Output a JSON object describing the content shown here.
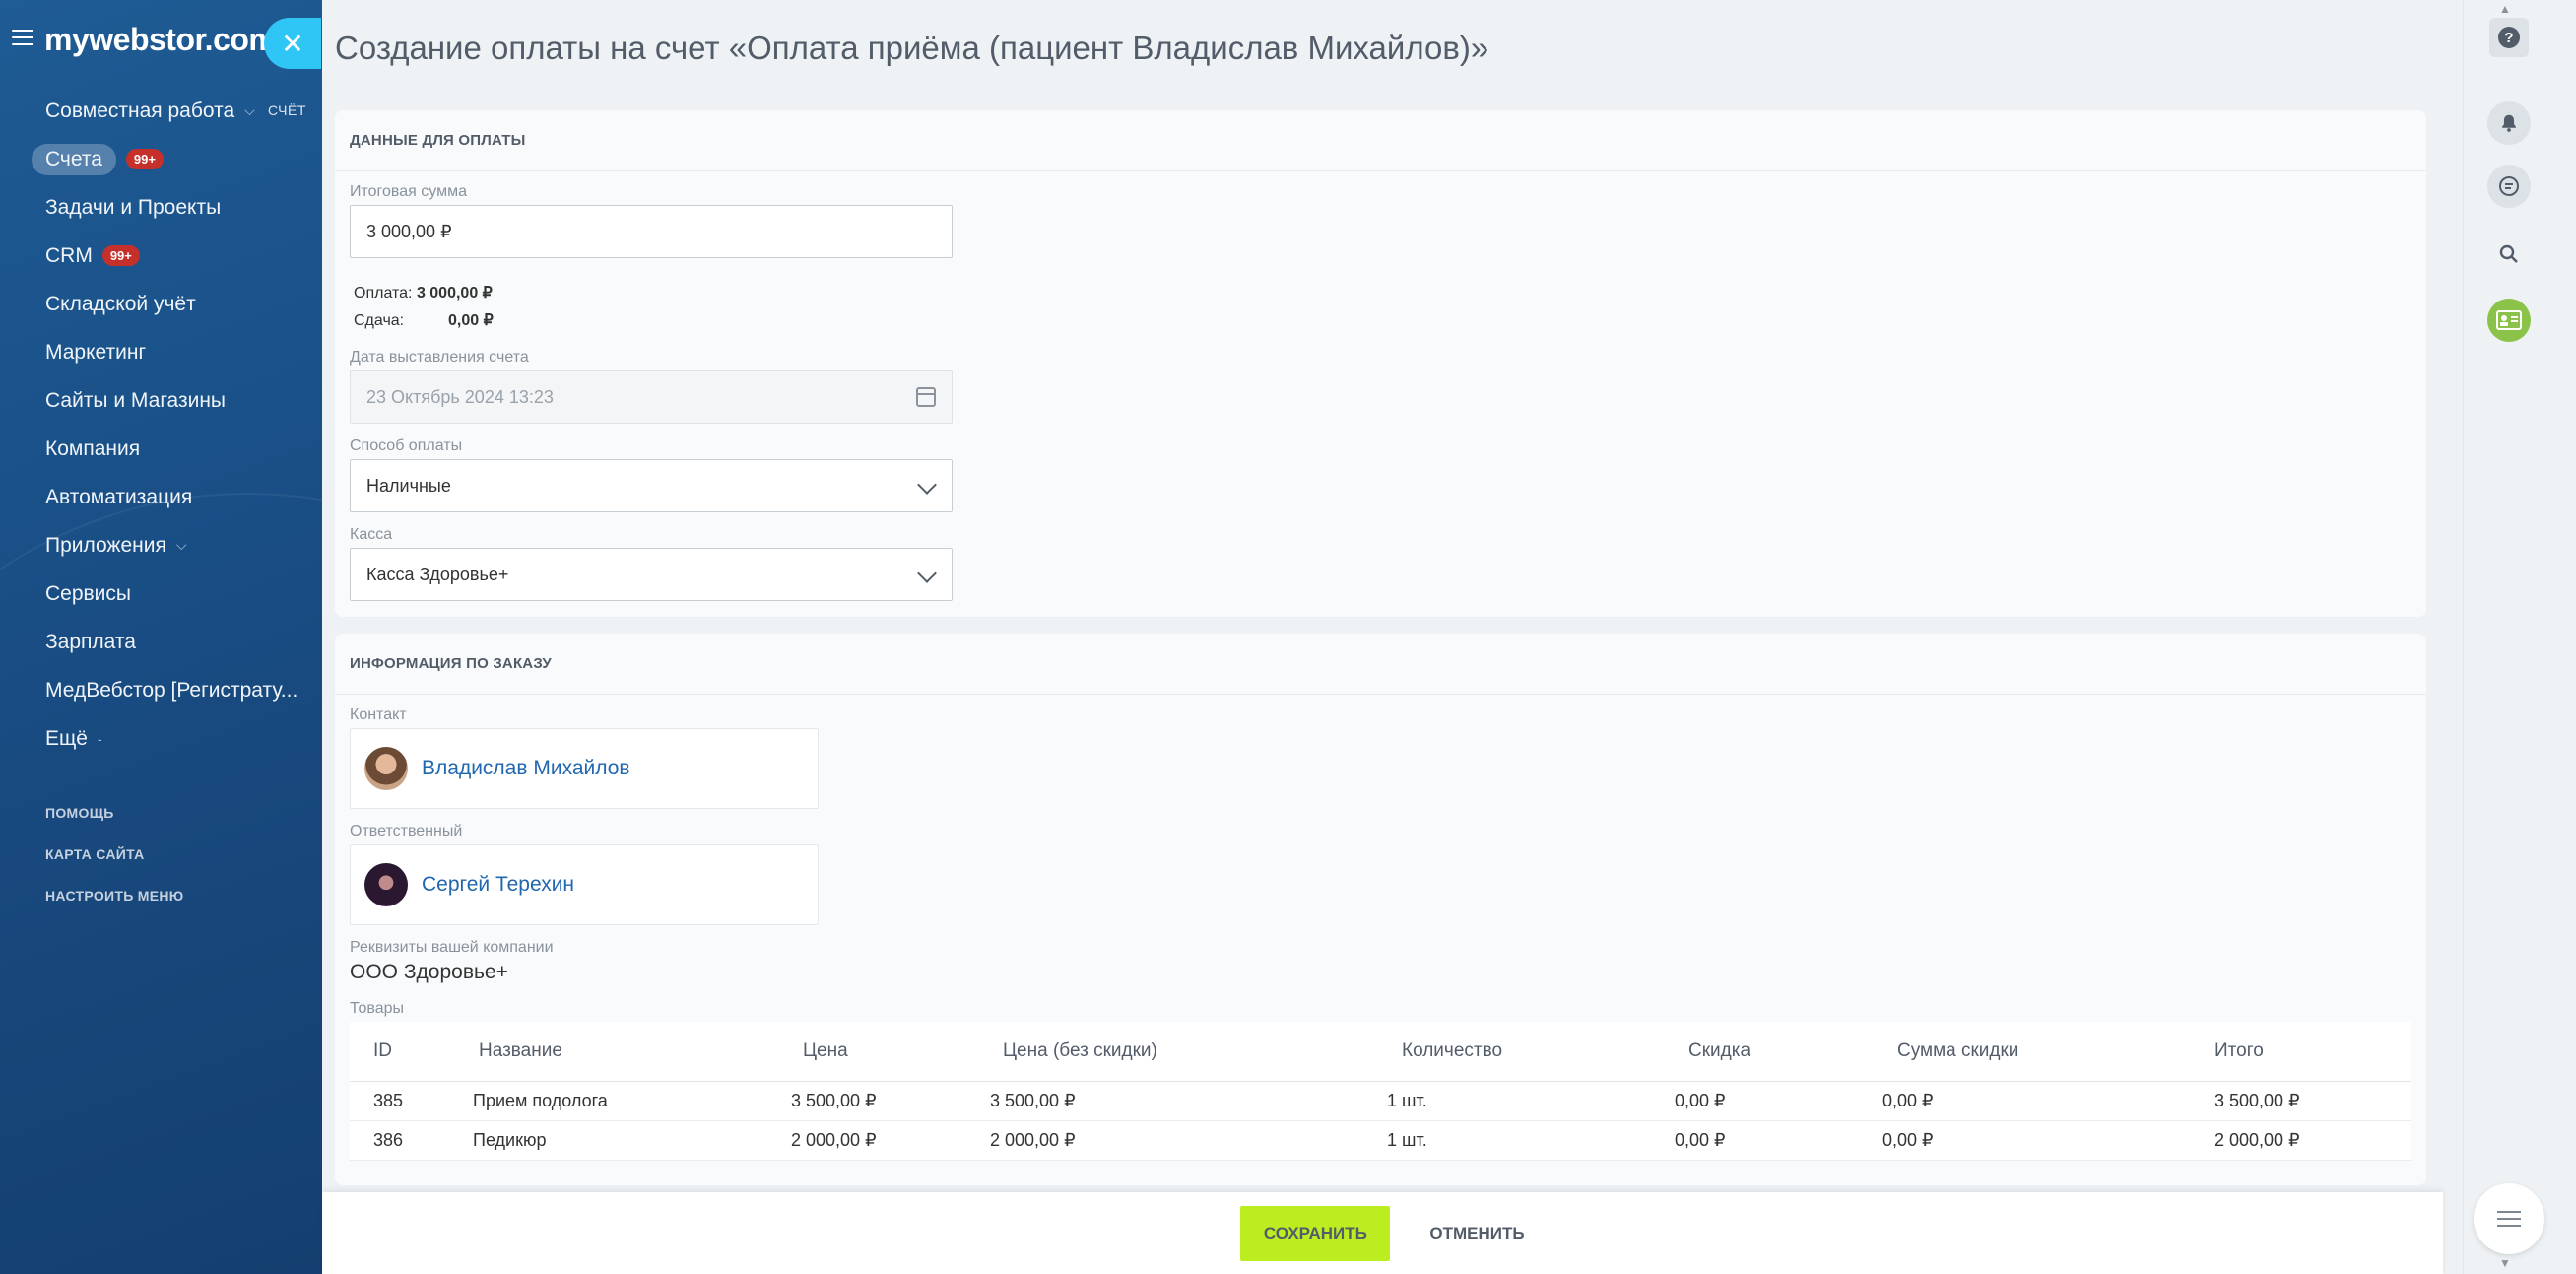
{
  "sidebar": {
    "logo": "mywebstor.com",
    "items": [
      {
        "label": "Совместная работа",
        "badge": "",
        "chevron": true
      },
      {
        "label": "Счета",
        "badge": "99+",
        "chevron": false,
        "active": true
      },
      {
        "label": "Задачи и Проекты",
        "badge": "",
        "chevron": false
      },
      {
        "label": "CRM",
        "badge": "99+",
        "chevron": false
      },
      {
        "label": "Складской учёт",
        "badge": "",
        "chevron": false
      },
      {
        "label": "Маркетинг",
        "badge": "",
        "chevron": false
      },
      {
        "label": "Сайты и Магазины",
        "badge": "",
        "chevron": false
      },
      {
        "label": "Компания",
        "badge": "",
        "chevron": false
      },
      {
        "label": "Автоматизация",
        "badge": "",
        "chevron": false
      },
      {
        "label": "Приложения",
        "badge": "",
        "chevron": true
      },
      {
        "label": "Сервисы",
        "badge": "",
        "chevron": false
      },
      {
        "label": "Зарплата",
        "badge": "",
        "chevron": false
      },
      {
        "label": "МедВебстор [Регистрату...",
        "badge": "",
        "chevron": false
      },
      {
        "label": "Ещё",
        "badge": "",
        "chevron": true
      }
    ],
    "submenu": [
      "ПОМОЩЬ",
      "КАРТА САЙТА",
      "НАСТРОИТЬ МЕНЮ"
    ]
  },
  "slider": {
    "close_icon": "close-icon",
    "label": "СЧЁТ"
  },
  "page": {
    "title": "Создание оплаты на счет «Оплата приёма (пациент Владислав Михайлов)»"
  },
  "payment": {
    "section_title": "ДАННЫЕ ДЛЯ ОПЛАТЫ",
    "total_label": "Итоговая сумма",
    "total_value": "3 000,00 ₽",
    "paid_label": "Оплата:",
    "paid_value": "3 000,00 ₽",
    "change_label": "Сдача:",
    "change_value": "0,00 ₽",
    "date_label": "Дата выставления счета",
    "date_value": "23 Октябрь 2024 13:23",
    "method_label": "Способ оплаты",
    "method_value": "Наличные",
    "cashbox_label": "Касса",
    "cashbox_value": "Касса Здоровье+"
  },
  "order": {
    "section_title": "ИНФОРМАЦИЯ ПО ЗАКАЗУ",
    "contact_label": "Контакт",
    "contact_name": "Владислав Михайлов",
    "responsible_label": "Ответственный",
    "responsible_name": "Сергей Терехин",
    "company_label": "Реквизиты вашей компании",
    "company_value": "ООО Здоровье+",
    "goods_label": "Товары",
    "columns": [
      "ID",
      "Название",
      "Цена",
      "Цена (без скидки)",
      "Количество",
      "Скидка",
      "Сумма скидки",
      "Итого"
    ],
    "rows": [
      [
        "385",
        "Прием подолога",
        "3 500,00 ₽",
        "3 500,00 ₽",
        "1 шт.",
        "0,00 ₽",
        "0,00 ₽",
        "3 500,00 ₽"
      ],
      [
        "386",
        "Педикюр",
        "2 000,00 ₽",
        "2 000,00 ₽",
        "1 шт.",
        "0,00 ₽",
        "0,00 ₽",
        "2 000,00 ₽"
      ]
    ]
  },
  "actions": {
    "save": "СОХРАНИТЬ",
    "cancel": "ОТМЕНИТЬ"
  },
  "right_panel": {
    "help": "?",
    "icons": [
      "bell-icon",
      "chat-icon",
      "search-icon",
      "contact-card-icon",
      "list-icon"
    ]
  }
}
